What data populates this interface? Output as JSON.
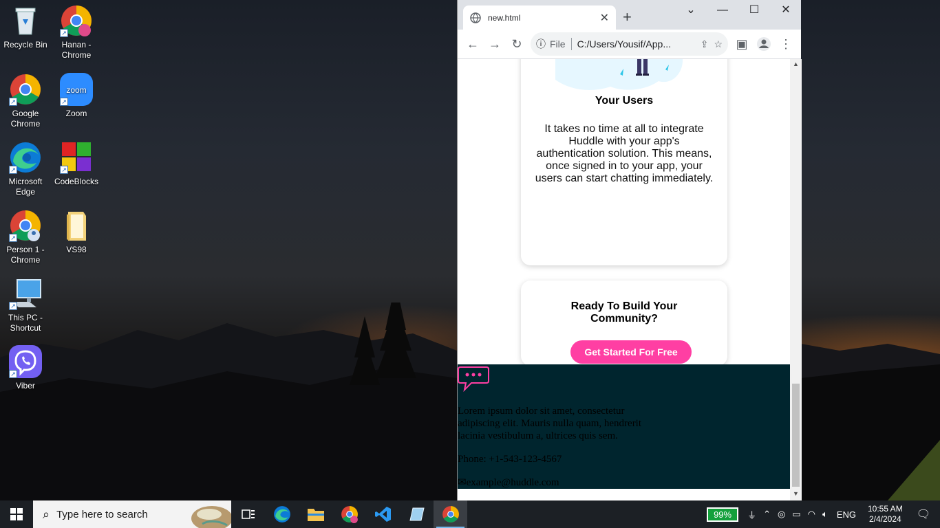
{
  "desktop": {
    "icons": [
      {
        "label": "Recycle Bin",
        "icon": "recycle-bin-icon"
      },
      {
        "label": "Hanan - Chrome",
        "icon": "chrome-profile-icon"
      },
      {
        "label": "Google Chrome",
        "icon": "chrome-icon"
      },
      {
        "label": "Zoom",
        "icon": "zoom-icon"
      },
      {
        "label": "Microsoft Edge",
        "icon": "edge-icon"
      },
      {
        "label": "CodeBlocks",
        "icon": "codeblocks-icon"
      },
      {
        "label": "Person 1 - Chrome",
        "icon": "chrome-profile-icon"
      },
      {
        "label": "VS98",
        "icon": "folder-icon"
      },
      {
        "label": "This PC - Shortcut",
        "icon": "computer-icon"
      },
      {
        "label": "Viber",
        "icon": "viber-icon"
      }
    ]
  },
  "browser": {
    "tab_title": "new.html",
    "file_label": "File",
    "url": "C:/Users/Yousif/App..."
  },
  "page": {
    "card1": {
      "title": "Your Users",
      "text": "It takes no time at all to integrate Huddle with your app's authentication solution. This means, once signed in to your app, your users can start chatting immediately."
    },
    "card2": {
      "title": "Ready To Build Your Community?",
      "cta": "Get Started For Free"
    },
    "footer": {
      "description": "Lorem ipsum dolor sit amet, consectetur adipiscing elit. Mauris nulla quam, hendrerit lacinia vestibulum a, ultrices quis sem.",
      "phone": "Phone: +1-543-123-4567",
      "email": "example@huddle.com"
    },
    "colors": {
      "accent": "#ff3fa3",
      "footer_bg": "#00252e"
    }
  },
  "taskbar": {
    "search_placeholder": "Type here to search",
    "battery": "99%",
    "language": "ENG",
    "time": "10:55 AM",
    "date": "2/4/2024"
  }
}
